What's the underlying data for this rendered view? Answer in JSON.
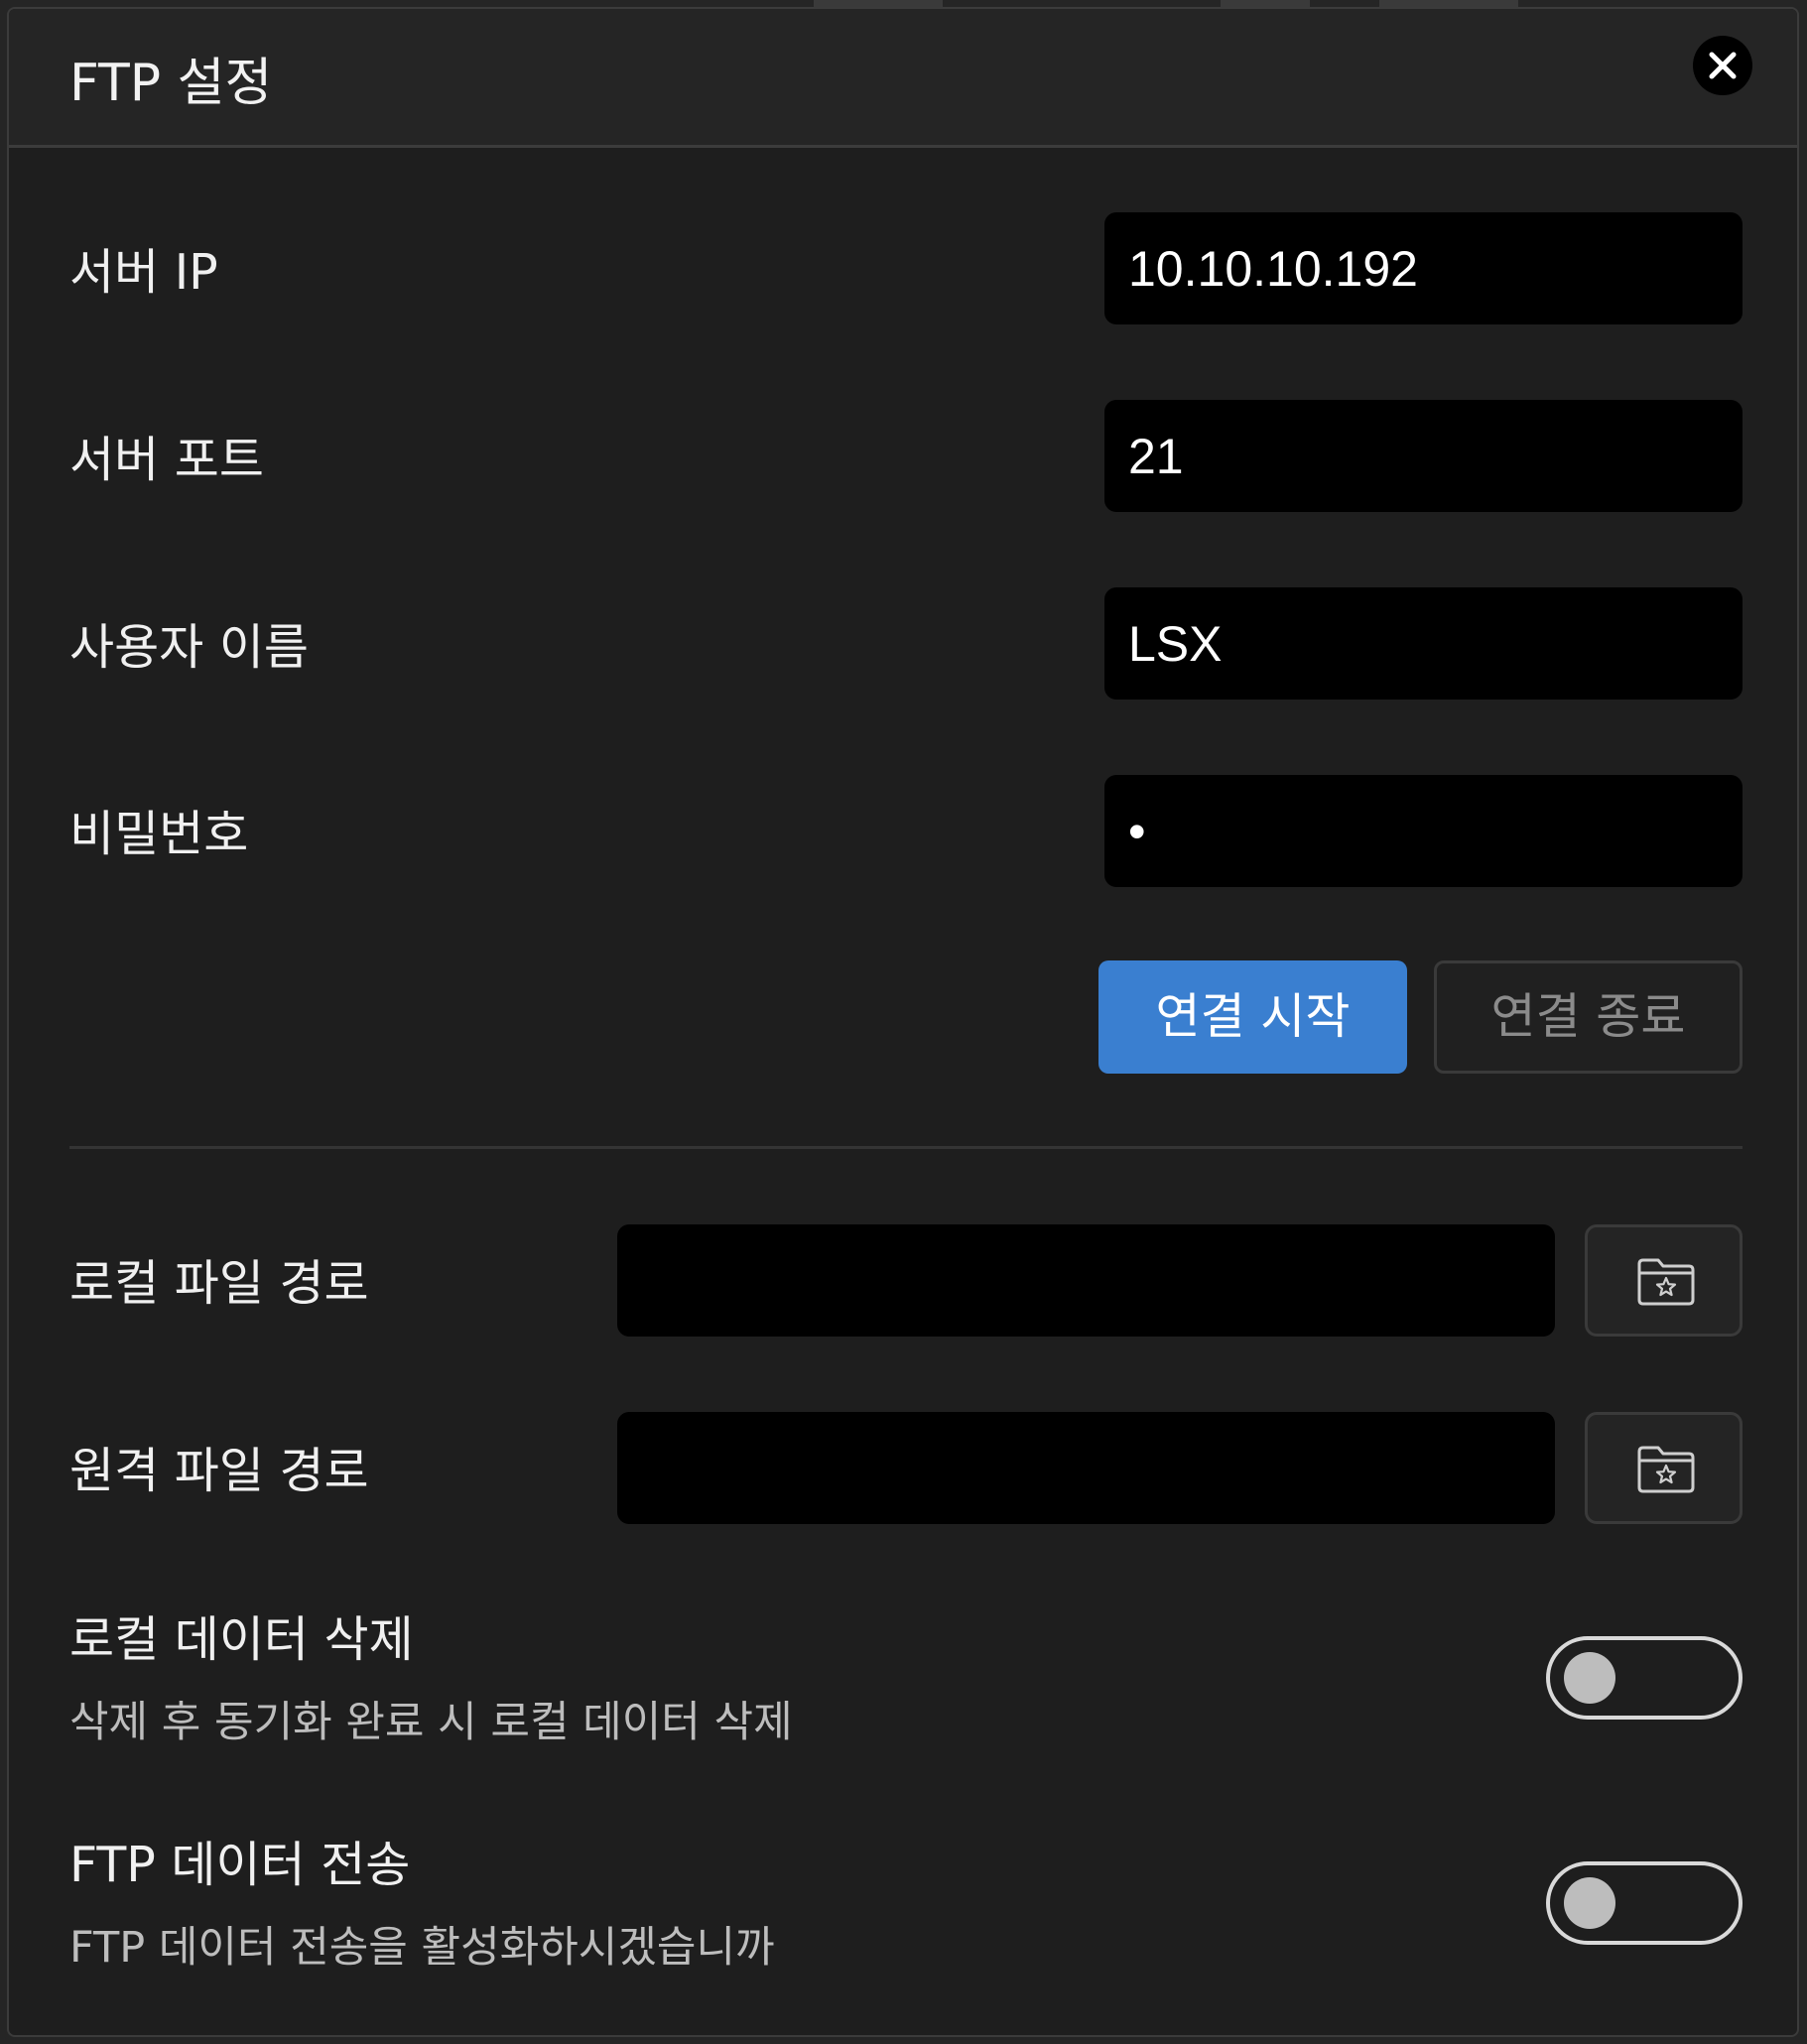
{
  "dialog": {
    "title": "FTP 설정",
    "close_icon": "close-icon"
  },
  "server_ip": {
    "label": "서버 IP",
    "value": "10.10.10.192"
  },
  "server_port": {
    "label": "서버 포트",
    "value": "21"
  },
  "username": {
    "label": "사용자 이름",
    "value": "LSX"
  },
  "password": {
    "label": "비밀번호",
    "value": "•"
  },
  "buttons": {
    "connect": "연결 시작",
    "disconnect": "연결 종료"
  },
  "local_path": {
    "label": "로컬 파일 경로",
    "value": "",
    "browse_icon": "folder-star-icon"
  },
  "remote_path": {
    "label": "원격 파일 경로",
    "value": "",
    "browse_icon": "folder-star-icon"
  },
  "delete_local": {
    "title": "로컬 데이터 삭제",
    "description": "삭제 후 동기화 완료 시 로컬 데이터 삭제",
    "enabled": false
  },
  "ftp_transfer": {
    "title": "FTP 데이터 전송",
    "description": "FTP 데이터 전송을 활성화하시겠습니까",
    "enabled": false
  },
  "colors": {
    "background": "#1e1e1e",
    "header": "#252525",
    "input": "#000000",
    "primary_button": "#3a7fd0",
    "muted_text": "#bdbdbd"
  }
}
